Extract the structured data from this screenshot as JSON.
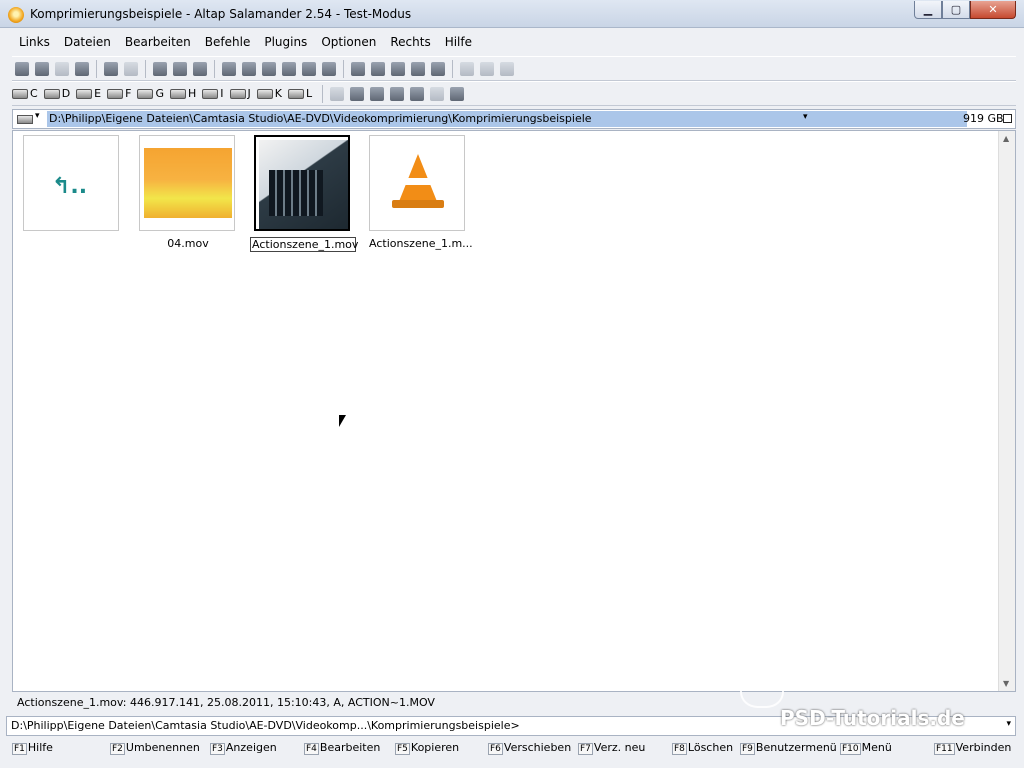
{
  "window": {
    "title": "Komprimierungsbeispiele - Altap Salamander 2.54 - Test-Modus",
    "controls": {
      "minimize": "▁",
      "maximize": "▢",
      "close": "✕"
    }
  },
  "menubar": {
    "items": [
      "Links",
      "Dateien",
      "Bearbeiten",
      "Befehle",
      "Plugins",
      "Optionen",
      "Rechts",
      "Hilfe"
    ],
    "underlines": [
      "L",
      "D",
      "B",
      "f",
      "P",
      "O",
      "R",
      "H"
    ]
  },
  "drives": [
    "C",
    "D",
    "E",
    "F",
    "G",
    "H",
    "I",
    "J",
    "K",
    "L"
  ],
  "path": {
    "text": "D:\\Philipp\\Eigene Dateien\\Camtasia Studio\\AE-DVD\\Videokomprimierung\\Komprimierungsbeispiele",
    "free_space": "919 GB",
    "dropdown_arrow": "▾"
  },
  "files": [
    {
      "name": "",
      "type": "up-dir",
      "glyph": "↰.."
    },
    {
      "name": "04.mov",
      "type": "video-fire"
    },
    {
      "name": "Actionszene_1.mov",
      "type": "video-building",
      "selected": true
    },
    {
      "name": "Actionszene_1.m...",
      "type": "vlc"
    }
  ],
  "status": {
    "info": "Actionszene_1.mov: 446.917.141, 25.08.2011, 15:10:43, A, ACTION~1.MOV"
  },
  "command_line": {
    "value": "D:\\Philipp\\Eigene Dateien\\Camtasia Studio\\AE-DVD\\Videokomp...\\Komprimierungsbeispiele>",
    "arrow": "▾"
  },
  "function_keys": [
    {
      "key": "F1",
      "label": "Hilfe"
    },
    {
      "key": "F2",
      "label": "Umbenennen"
    },
    {
      "key": "F3",
      "label": "Anzeigen"
    },
    {
      "key": "F4",
      "label": "Bearbeiten"
    },
    {
      "key": "F5",
      "label": "Kopieren"
    },
    {
      "key": "F6",
      "label": "Verschieben"
    },
    {
      "key": "F7",
      "label": "Verz. neu"
    },
    {
      "key": "F8",
      "label": "Löschen"
    },
    {
      "key": "F9",
      "label": "Benutzermenü"
    },
    {
      "key": "F10",
      "label": "Menü"
    },
    {
      "key": "F11",
      "label": "Verbinden"
    }
  ],
  "watermark": "PSD-Tutorials.de",
  "colors": {
    "path_highlight": "#abc6e9",
    "titlebar": "#c9d5e6",
    "selection_border": "#000000"
  }
}
